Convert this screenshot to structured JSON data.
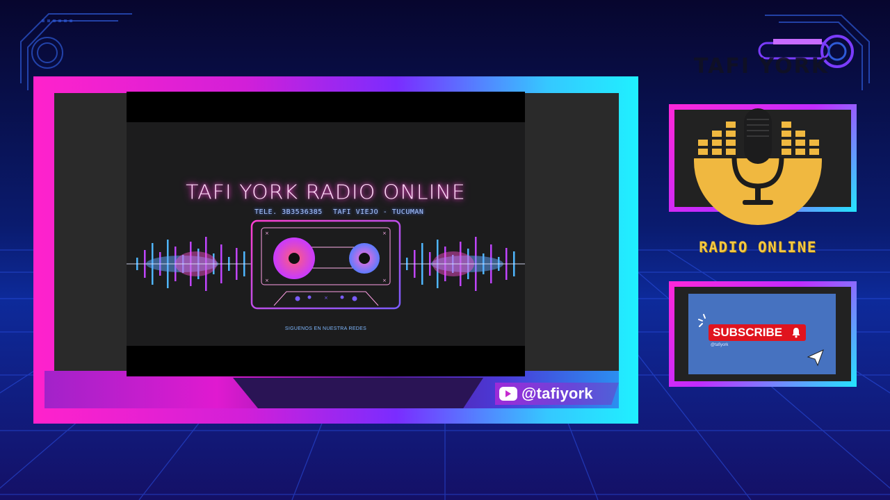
{
  "video": {
    "title": "TAFI YORK RADIO ONLINE",
    "phone": "TELE. 3B3536385",
    "location": "TAFI VIEJO - TUCUMAN",
    "follow": "SIGUENOS EN NUESTRA REDES"
  },
  "social": {
    "handle": "@tafiyork",
    "icon": "youtube-icon"
  },
  "brand": {
    "title": "TAFI YORK",
    "tagline": "RADIO ONLINE"
  },
  "subscribe": {
    "label": "SUBSCRIBE",
    "handle": "@tafiyork",
    "icon": "bell-icon"
  },
  "colors": {
    "neon_pink": "#ff22cc",
    "neon_cyan": "#1ff0ff",
    "gold": "#f5c842",
    "youtube_red": "#e0141e",
    "background": "#0a0a3a"
  }
}
